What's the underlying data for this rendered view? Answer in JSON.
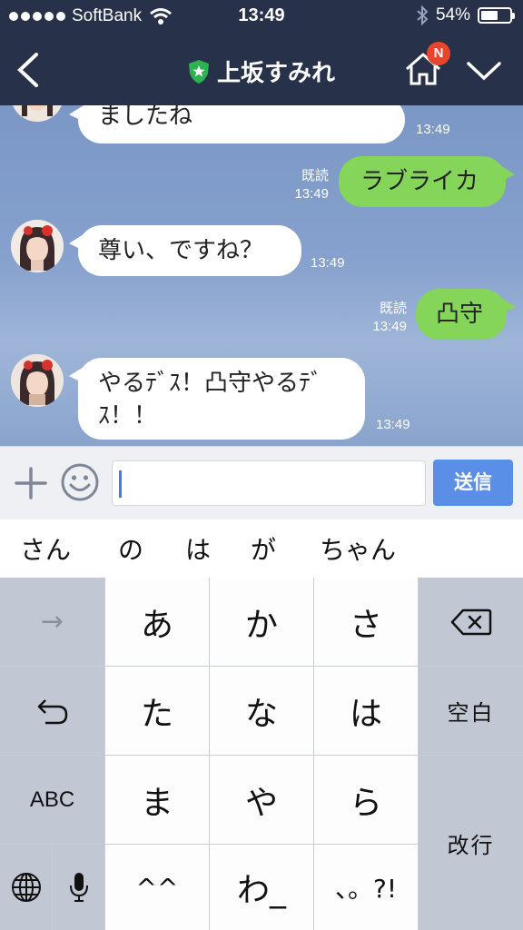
{
  "status": {
    "carrier": "SoftBank",
    "time": "13:49",
    "battery": "54%",
    "battery_level": 0.54
  },
  "nav": {
    "title": "上坂すみれ",
    "badge": "N",
    "icons": [
      "back-chevron-icon",
      "shield-star-icon",
      "home-icon",
      "chevron-down-icon"
    ]
  },
  "chat": {
    "messages": [
      {
        "side": "in",
        "text": "ましたね",
        "time": "13:49"
      },
      {
        "side": "out",
        "text": "ラブライカ",
        "read": "既読",
        "time": "13:49"
      },
      {
        "side": "in",
        "text": "尊い、ですね？",
        "time": "13:49"
      },
      {
        "side": "out",
        "text": "凸守",
        "read": "既読",
        "time": "13:49"
      },
      {
        "side": "in",
        "text": "やるﾃﾞｽ！凸守やるﾃﾞｽ！！",
        "line1": "やるﾃﾞｽ！凸守やるﾃﾞ",
        "line2": "ｽ！！",
        "time": "13:49"
      }
    ]
  },
  "input": {
    "value": "",
    "send_label": "送信"
  },
  "suggestions": [
    "さん",
    "の",
    "は",
    "が",
    "ちゃん"
  ],
  "keyboard": {
    "row1": {
      "left": "→",
      "k1": "あ",
      "k2": "か",
      "k3": "さ",
      "right": "delete-icon"
    },
    "row2": {
      "left": "undo-icon",
      "k1": "た",
      "k2": "な",
      "k3": "は",
      "right": "空白"
    },
    "row3": {
      "left": "ABC",
      "k1": "ま",
      "k2": "や",
      "k3": "ら",
      "right": "改行"
    },
    "row4": {
      "k1": "^^",
      "k2": "わ_",
      "k3": "、。?!"
    }
  },
  "colors": {
    "header": "#27314a",
    "out_bubble": "#84d55a",
    "send": "#5b8ee6",
    "badge": "#e8452c"
  }
}
